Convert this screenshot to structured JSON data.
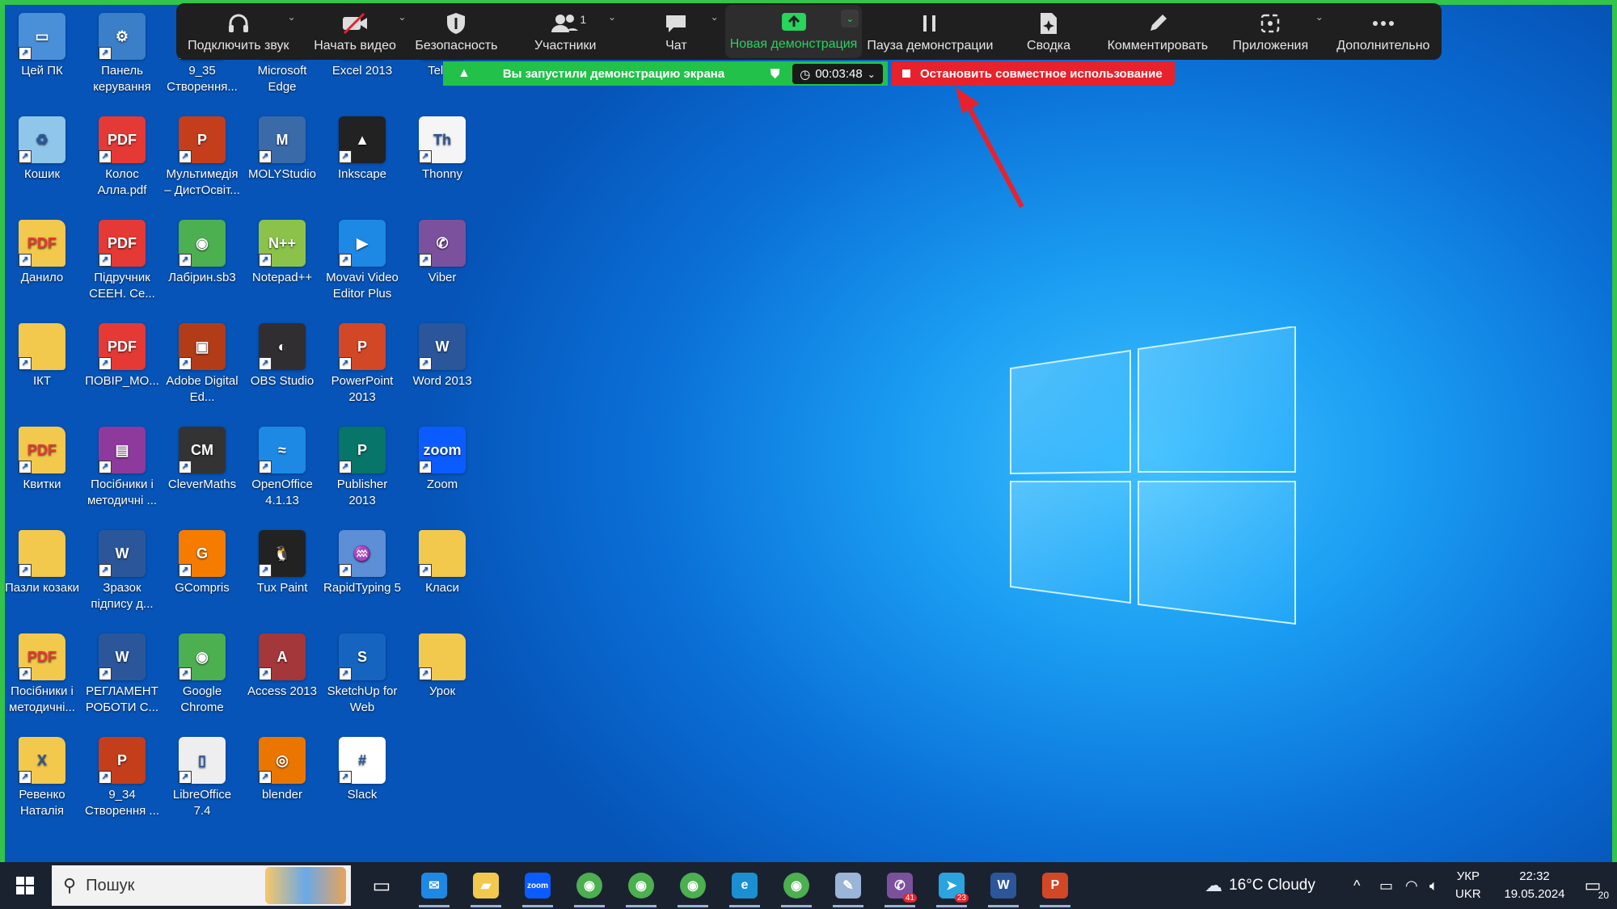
{
  "zoom_toolbar": {
    "audio": "Подключить звук",
    "video": "Начать видео",
    "security": "Безопасность",
    "participants": "Участники",
    "participants_count": "1",
    "chat": "Чат",
    "new_share": "Новая демонстрация",
    "pause_share": "Пауза демонстрации",
    "summary": "Сводка",
    "annotate": "Комментировать",
    "apps": "Приложения",
    "more": "Дополнительно"
  },
  "share_status": {
    "message": "Вы запустили демонстрацию экрана",
    "timer": "00:03:48",
    "stop": "Остановить совместное использование"
  },
  "desktop_icons": [
    {
      "label": "Цей ПК",
      "icon": "computer-icon",
      "color": "#4a90d9"
    },
    {
      "label": "Панель керування",
      "icon": "control-panel-icon",
      "color": "#3a7fc8"
    },
    {
      "label": "9_35 Створення...",
      "icon": "powerpoint-icon",
      "color": "#c43e1c"
    },
    {
      "label": "Microsoft Edge",
      "icon": "edge-icon",
      "color": "#1b8fd2"
    },
    {
      "label": "Excel 2013",
      "icon": "excel-icon",
      "color": "#1e7145"
    },
    {
      "label": "Teleg",
      "icon": "telegram-icon",
      "color": "#2aa3df"
    },
    {
      "label": "Кошик",
      "icon": "recycle-bin-icon",
      "color": "#8fc6ea"
    },
    {
      "label": "Колос Алла.pdf",
      "icon": "pdf-icon",
      "color": "#e53935"
    },
    {
      "label": "Мультимедія – ДистОсвіт...",
      "icon": "powerpoint-icon",
      "color": "#c43e1c"
    },
    {
      "label": "MOLYStudio",
      "icon": "molystudio-icon",
      "color": "#3a6aa8"
    },
    {
      "label": "Inkscape",
      "icon": "inkscape-icon",
      "color": "#222"
    },
    {
      "label": "Thonny",
      "icon": "thonny-icon",
      "color": "#f5f5f5"
    },
    {
      "label": "Данило",
      "icon": "pdf-folder-icon",
      "color": "#f2c94c"
    },
    {
      "label": "Підручник СЕЕН. Се...",
      "icon": "pdf-icon",
      "color": "#e53935"
    },
    {
      "label": "Лабірин.sb3",
      "icon": "chrome-icon",
      "color": "#4caf50"
    },
    {
      "label": "Notepad++",
      "icon": "notepad-plus-icon",
      "color": "#8bc34a"
    },
    {
      "label": "Movavi Video Editor Plus",
      "icon": "movavi-icon",
      "color": "#1e88e5"
    },
    {
      "label": "Viber",
      "icon": "viber-icon",
      "color": "#7b519d"
    },
    {
      "label": "ІКТ",
      "icon": "folder-icon",
      "color": "#f2c94c"
    },
    {
      "label": "ПОВІР_МО...",
      "icon": "pdf-icon",
      "color": "#e53935"
    },
    {
      "label": "Adobe Digital Ed...",
      "icon": "adobe-digital-editions-icon",
      "color": "#b23c17"
    },
    {
      "label": "OBS Studio",
      "icon": "obs-icon",
      "color": "#302e31"
    },
    {
      "label": "PowerPoint 2013",
      "icon": "powerpoint-icon",
      "color": "#d24726"
    },
    {
      "label": "Word 2013",
      "icon": "word-icon",
      "color": "#2b579a"
    },
    {
      "label": "Квитки",
      "icon": "pdf-folder-icon",
      "color": "#f2c94c"
    },
    {
      "label": "Посібники і методичні ...",
      "icon": "winrar-icon",
      "color": "#8e3a9d"
    },
    {
      "label": "CleverMaths",
      "icon": "clevermaths-icon",
      "color": "#333"
    },
    {
      "label": "OpenOffice 4.1.13",
      "icon": "openoffice-icon",
      "color": "#1e88e5"
    },
    {
      "label": "Publisher 2013",
      "icon": "publisher-icon",
      "color": "#077568"
    },
    {
      "label": "Zoom",
      "icon": "zoom-icon",
      "color": "#0b5cff"
    },
    {
      "label": "Пазли козаки",
      "icon": "folder-icon",
      "color": "#f2c94c"
    },
    {
      "label": "Зразок підпису д...",
      "icon": "word-doc-icon",
      "color": "#2b579a"
    },
    {
      "label": "GCompris",
      "icon": "gcompris-icon",
      "color": "#f57c00"
    },
    {
      "label": "Tux Paint",
      "icon": "tux-paint-icon",
      "color": "#222"
    },
    {
      "label": "RapidTyping 5",
      "icon": "rapidtyping-icon",
      "color": "#5c8fd6"
    },
    {
      "label": "Класи",
      "icon": "folder-icon",
      "color": "#f2c94c"
    },
    {
      "label": "Посібники і методичні...",
      "icon": "pdf-folder-icon",
      "color": "#f2c94c"
    },
    {
      "label": "РЕГЛАМЕНТ РОБОТИ С...",
      "icon": "word-doc-icon",
      "color": "#2b579a"
    },
    {
      "label": "Google Chrome",
      "icon": "chrome-icon",
      "color": "#4caf50"
    },
    {
      "label": "Access 2013",
      "icon": "access-icon",
      "color": "#a4373a"
    },
    {
      "label": "SketchUp for Web",
      "icon": "sketchup-icon",
      "color": "#1565c0"
    },
    {
      "label": "Урок",
      "icon": "folder-icon",
      "color": "#f2c94c"
    },
    {
      "label": "Ревенко Наталія",
      "icon": "excel-folder-icon",
      "color": "#f2c94c"
    },
    {
      "label": "9_34 Створення ...",
      "icon": "powerpoint-icon",
      "color": "#c43e1c"
    },
    {
      "label": "LibreOffice 7.4",
      "icon": "libreoffice-icon",
      "color": "#eee"
    },
    {
      "label": "blender",
      "icon": "blender-icon",
      "color": "#ea7600"
    },
    {
      "label": "Slack",
      "icon": "slack-icon",
      "color": "#fff"
    }
  ],
  "taskbar": {
    "search_placeholder": "Пошук",
    "apps": [
      {
        "name": "mail-icon",
        "color": "#1e88e5",
        "badge": ""
      },
      {
        "name": "file-explorer-icon",
        "color": "#f2c94c",
        "badge": ""
      },
      {
        "name": "zoom-icon",
        "color": "#0b5cff",
        "badge": ""
      },
      {
        "name": "chrome-icon",
        "color": "#4caf50",
        "badge": ""
      },
      {
        "name": "chrome-icon",
        "color": "#4caf50",
        "badge": ""
      },
      {
        "name": "chrome-icon",
        "color": "#4caf50",
        "badge": ""
      },
      {
        "name": "edge-icon",
        "color": "#1b8fd2",
        "badge": ""
      },
      {
        "name": "chrome-icon",
        "color": "#4caf50",
        "badge": ""
      },
      {
        "name": "paint-icon",
        "color": "#9bb5d9",
        "badge": ""
      },
      {
        "name": "viber-icon",
        "color": "#7b519d",
        "badge": "41"
      },
      {
        "name": "telegram-icon",
        "color": "#2aa3df",
        "badge": "23"
      },
      {
        "name": "word-icon",
        "color": "#2b579a",
        "badge": ""
      },
      {
        "name": "powerpoint-icon",
        "color": "#d24726",
        "badge": ""
      }
    ],
    "weather": "16°C  Cloudy",
    "lang_top": "УКР",
    "lang_bottom": "UKR",
    "time": "22:32",
    "date": "19.05.2024",
    "notifications": "20"
  }
}
